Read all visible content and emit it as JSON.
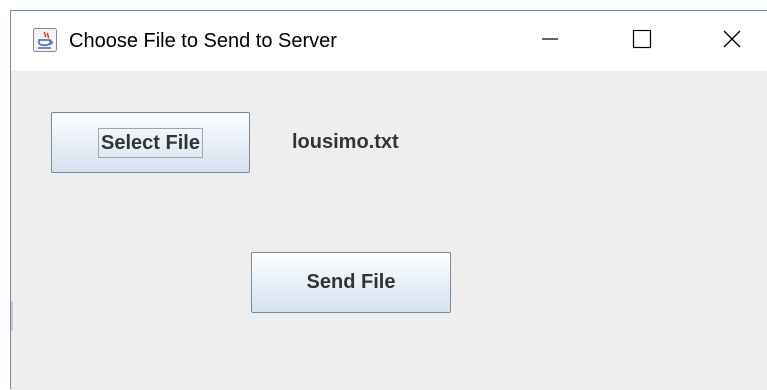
{
  "window": {
    "title": "Choose File to Send to Server",
    "app_icon": "java-cup-icon",
    "controls": {
      "minimize_icon": "minimize-icon",
      "maximize_icon": "maximize-icon",
      "close_icon": "close-icon"
    }
  },
  "content": {
    "select_button_label": "Select File",
    "selected_file_name": "lousimo.txt",
    "send_button_label": "Send File"
  },
  "colors": {
    "window_background": "#eeeeee",
    "titlebar_background": "#ffffff",
    "window_border": "#6b8fb5",
    "button_border": "#7a8a99",
    "text": "#333333"
  }
}
